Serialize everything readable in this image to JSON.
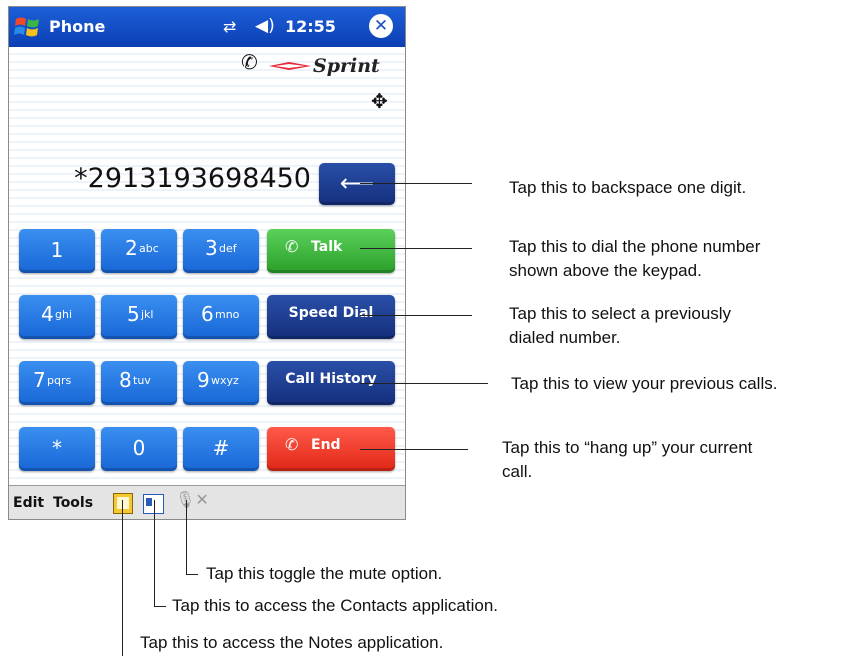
{
  "titlebar": {
    "app_title": "Phone",
    "time": "12:55",
    "close": "✕",
    "windows_icon": "windows-start-icon",
    "connectivity_icon": "connectivity-icon",
    "volume_icon": "volume-icon"
  },
  "brand": {
    "name": "Sprint",
    "roaming_icon": "roaming-icon",
    "nav_icon": "navigation-icon"
  },
  "dialer": {
    "number": "*2913193698450",
    "backspace_symbol": "⟵"
  },
  "keypad": [
    {
      "digit": "1",
      "letters": ""
    },
    {
      "digit": "2",
      "letters": "abc"
    },
    {
      "digit": "3",
      "letters": "def"
    },
    {
      "digit": "4",
      "letters": "ghi"
    },
    {
      "digit": "5",
      "letters": "jkl"
    },
    {
      "digit": "6",
      "letters": "mno"
    },
    {
      "digit": "7",
      "letters": "pqrs"
    },
    {
      "digit": "8",
      "letters": "tuv"
    },
    {
      "digit": "9",
      "letters": "wxyz"
    },
    {
      "digit": "*",
      "letters": ""
    },
    {
      "digit": "0",
      "letters": ""
    },
    {
      "digit": "#",
      "letters": ""
    }
  ],
  "actions": {
    "talk": "Talk",
    "speed_dial": "Speed Dial",
    "call_history": "Call History",
    "end": "End"
  },
  "menubar": {
    "edit": "Edit",
    "tools": "Tools",
    "notes_icon": "notes-icon",
    "contacts_icon": "contacts-icon",
    "mute_icon": "microphone-mute-icon"
  },
  "annotations": {
    "backspace": "Tap this to backspace one digit.",
    "talk_line1": "Tap this to dial the phone number",
    "talk_line2": "shown above the keypad.",
    "speed_line1": "Tap this to select a previously",
    "speed_line2": "dialed number.",
    "history": "Tap this to view your previous calls.",
    "end_line1": "Tap this to “hang up” your current",
    "end_line2": "call.",
    "mute": "Tap this toggle the mute option.",
    "contacts": "Tap this to access the Contacts application.",
    "notes": "Tap this to access the Notes application."
  },
  "colors": {
    "titlebar": "#0c3fb4",
    "key_blue": "#1866d6",
    "key_navy": "#142f7c",
    "talk_green": "#2a9f2a",
    "end_red": "#e02616"
  }
}
